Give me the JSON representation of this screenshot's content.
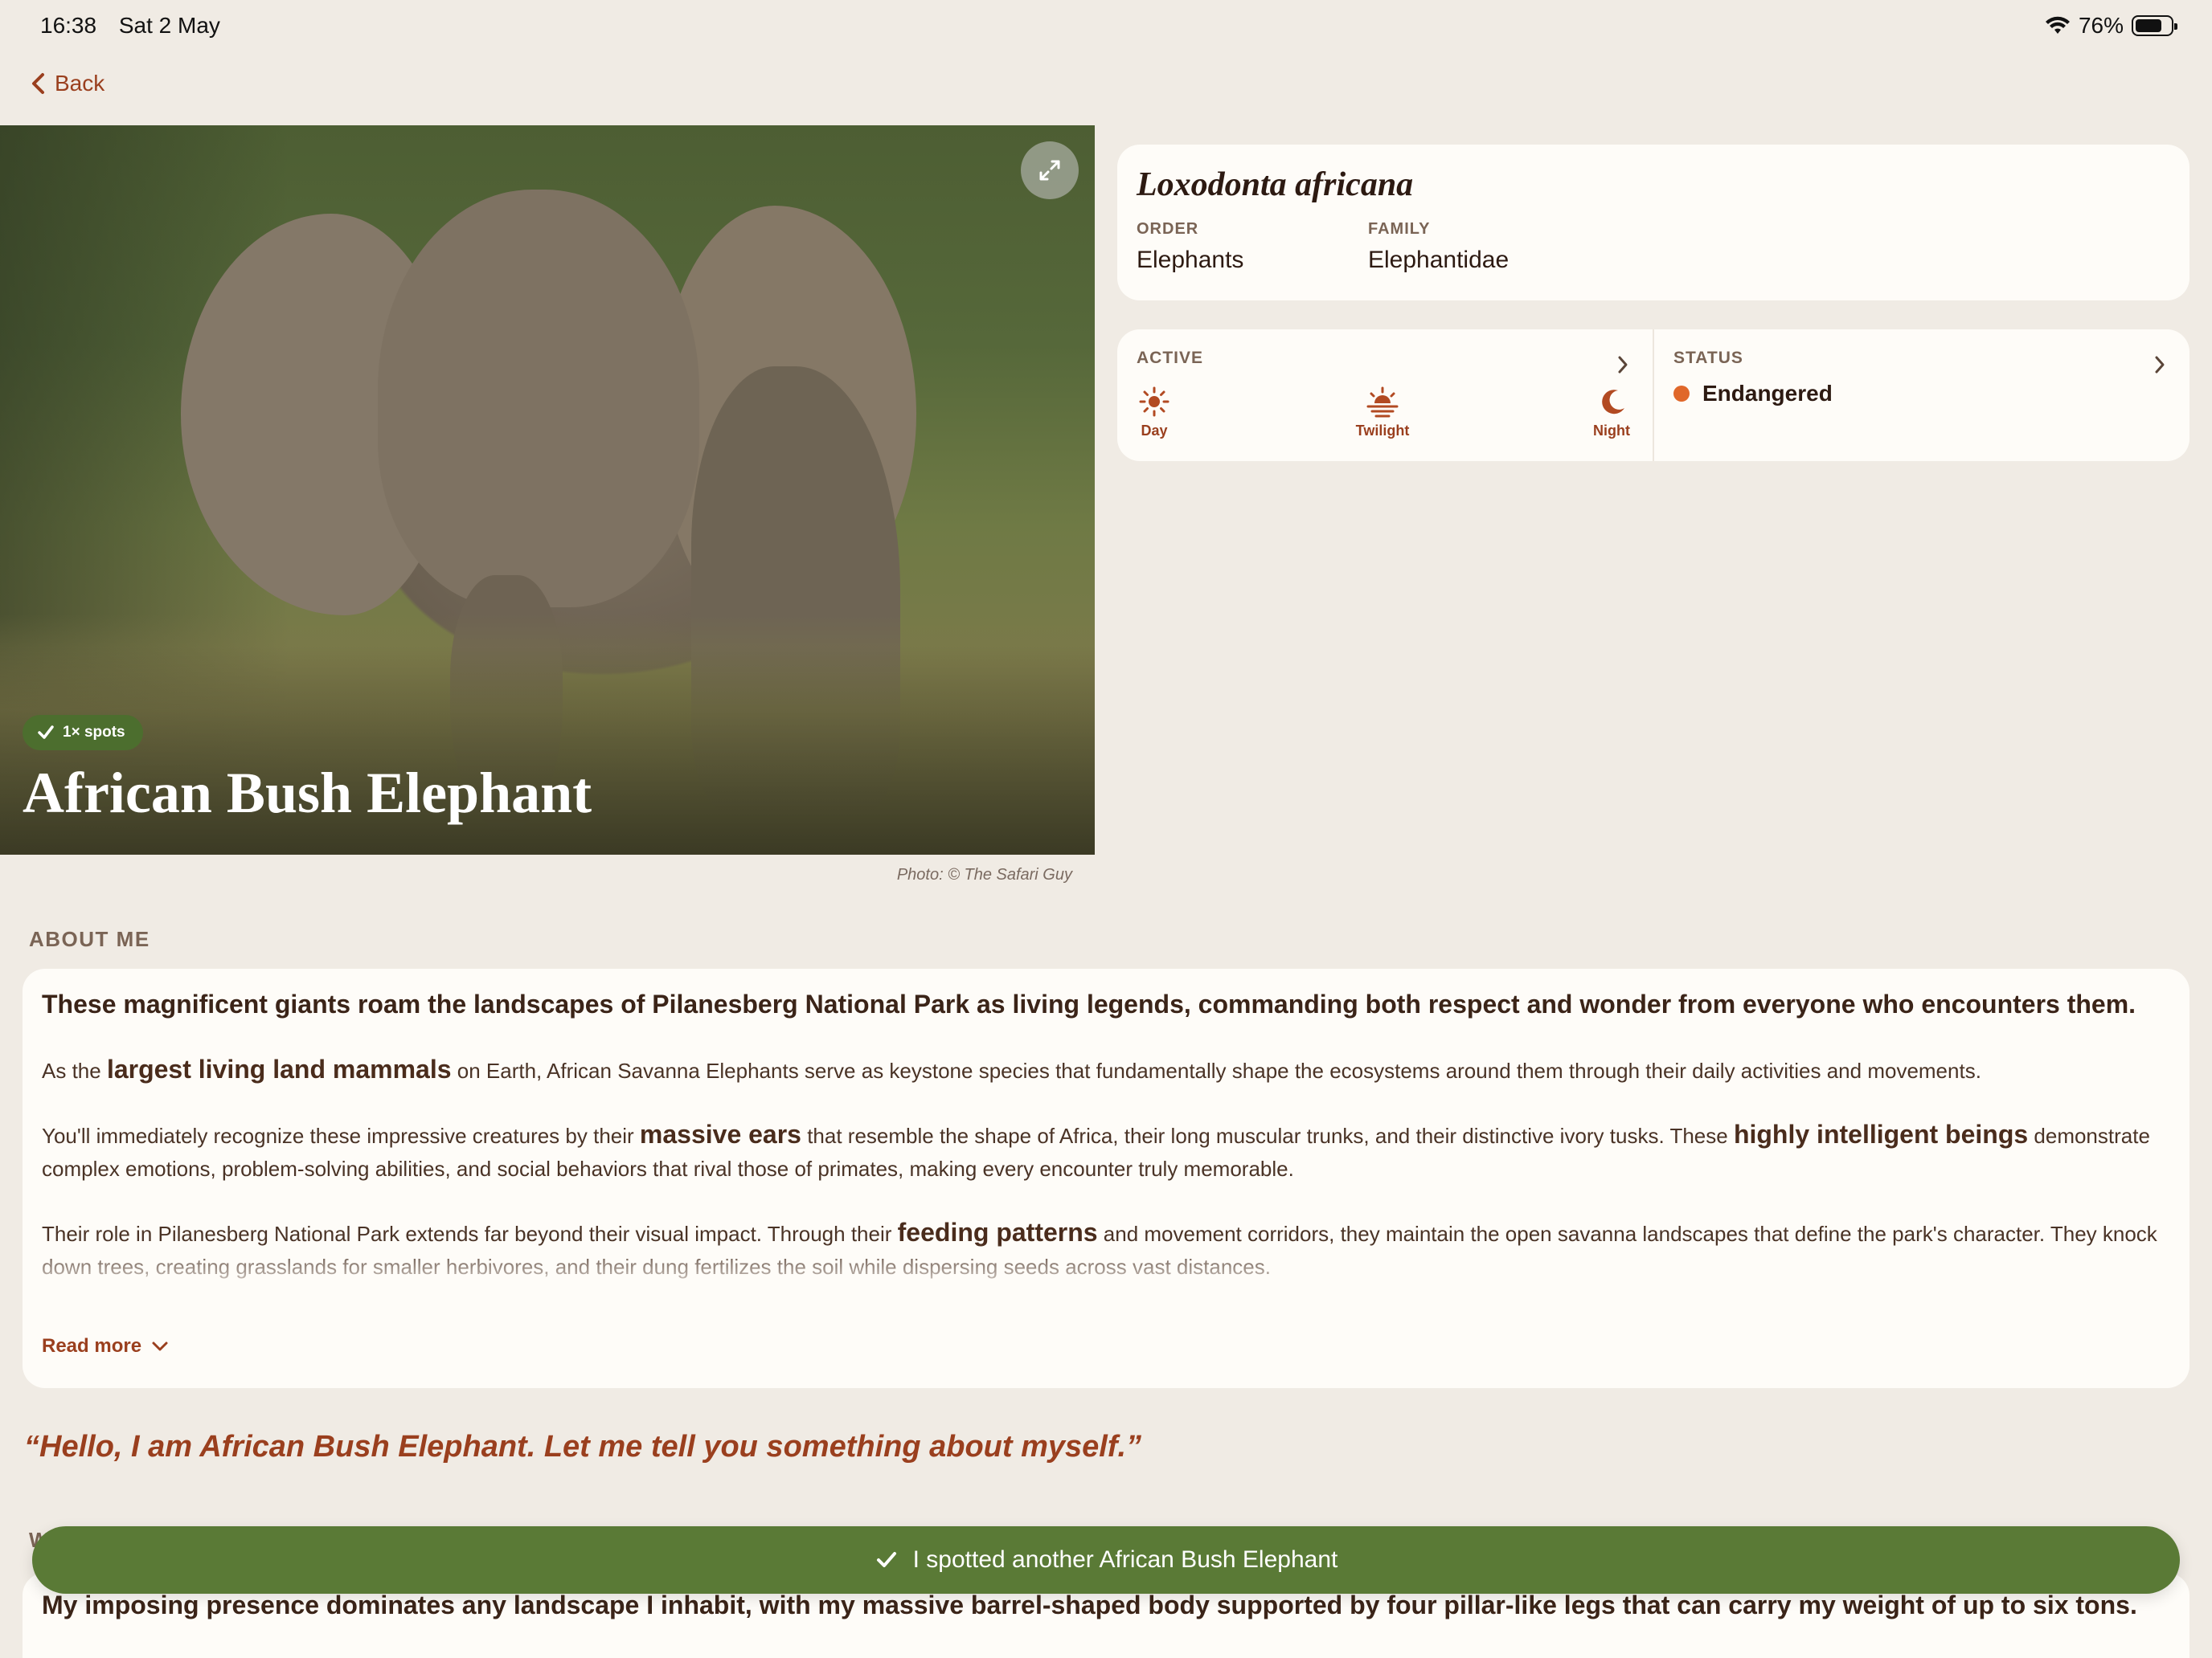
{
  "status_bar": {
    "time": "16:38",
    "date": "Sat 2 May",
    "battery": "76%"
  },
  "nav": {
    "back_label": "Back"
  },
  "hero": {
    "title": "African Bush Elephant",
    "spots_badge": "1× spots",
    "photo_credit": "Photo: © The Safari Guy",
    "icons": {
      "expand": "expand-icon",
      "check": "check-icon"
    }
  },
  "taxonomy": {
    "scientific_name": "Loxodonta africana",
    "order_label": "ORDER",
    "order_value": "Elephants",
    "family_label": "FAMILY",
    "family_value": "Elephantidae"
  },
  "activity": {
    "label": "ACTIVE",
    "items": [
      {
        "label": "Day",
        "icon": "sun-icon"
      },
      {
        "label": "Twilight",
        "icon": "sunset-icon"
      },
      {
        "label": "Night",
        "icon": "moon-icon"
      }
    ]
  },
  "status": {
    "label": "STATUS",
    "value": "Endangered",
    "dot_color": "#e0672a"
  },
  "about": {
    "heading": "ABOUT ME",
    "lead": "These magnificent giants roam the landscapes of Pilanesberg National Park as living legends, commanding both respect and wonder from everyone who encounters them.",
    "p1_a": "As the ",
    "p1_b": "largest living land mammals",
    "p1_c": " on Earth, African Savanna Elephants serve as keystone species that fundamentally shape the ecosystems around them through their daily activities and movements.",
    "p2_a": "You'll immediately recognize these impressive creatures by their ",
    "p2_b": "massive ears",
    "p2_c": " that resemble the shape of Africa, their long muscular trunks, and their distinctive ivory tusks. These ",
    "p2_d": "highly intelligent beings",
    "p2_e": " demonstrate complex emotions, problem-solving abilities, and social behaviors that rival those of primates, making every encounter truly memorable.",
    "p3_a": "Their role in Pilanesberg National Park extends far beyond their visual impact. Through their ",
    "p3_b": "feeding patterns",
    "p3_c": " and movement corridors, they maintain the open savanna landscapes that define the park's character. They knock down trees, creating grasslands for smaller herbivores, and their dung fertilizes the soil while dispersing seeds across vast distances.",
    "read_more": "Read more"
  },
  "quote": "“Hello, I am African Bush Elephant. Let me tell you something about myself.”",
  "next_section": {
    "heading_partial": "W",
    "text": "My imposing presence dominates any landscape I inhabit, with my massive barrel-shaped body supported by four pillar-like legs that can carry my weight of up to six tons."
  },
  "cta": {
    "label": "I spotted another African Bush Elephant"
  },
  "colors": {
    "accent": "#9a3f1e",
    "green": "#5a7a36",
    "background": "#f0ebe4",
    "card": "#fefcf8"
  }
}
